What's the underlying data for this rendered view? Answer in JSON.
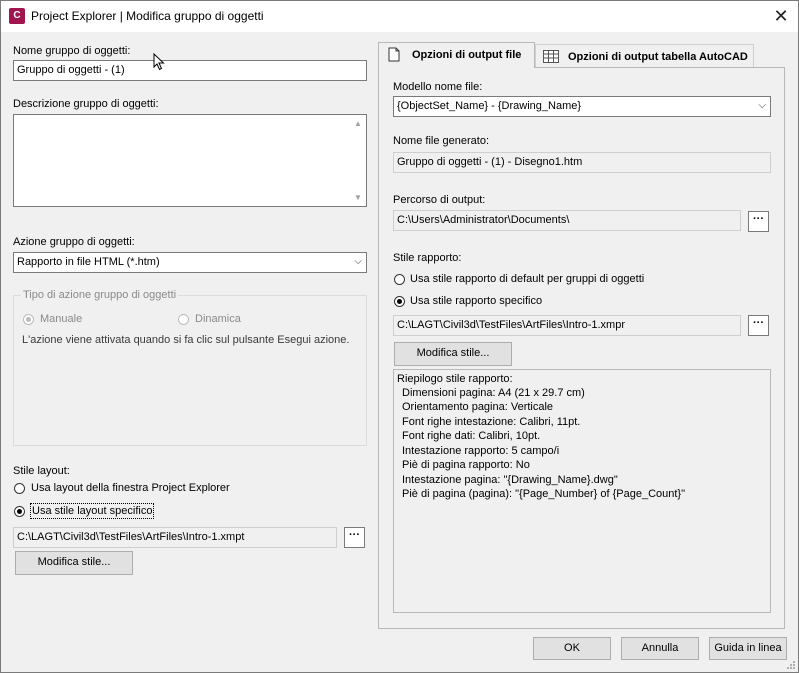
{
  "window": {
    "app_icon_text": "C",
    "title": "Project Explorer | Modifica gruppo di oggetti",
    "close_glyph": "✕"
  },
  "left": {
    "name_label": "Nome gruppo di oggetti:",
    "name_value": "Gruppo di oggetti - (1)",
    "desc_label": "Descrizione gruppo di oggetti:",
    "desc_value": "",
    "action_label": "Azione gruppo di oggetti:",
    "action_value": "Rapporto in file HTML (*.htm)",
    "action_type_group": {
      "title": "Tipo di azione gruppo di oggetti",
      "opt_manual": "Manuale",
      "opt_dynamic": "Dinamica",
      "selected": "Manuale",
      "note": "L'azione viene attivata quando si fa clic sul pulsante Esegui azione."
    },
    "layout_style_label": "Stile layout:",
    "layout_opt_window": "Usa layout della finestra Project Explorer",
    "layout_opt_specific": "Usa stile layout specifico",
    "layout_selected": "Usa stile layout specifico",
    "layout_path": "C:\\LAGT\\Civil3d\\TestFiles\\ArtFiles\\Intro-1.xmpt",
    "browse_glyph": "···",
    "modify_style_button": "Modifica stile..."
  },
  "tabs": [
    {
      "label": "Opzioni di output file",
      "icon": "document-icon",
      "active": true
    },
    {
      "label": "Opzioni di output tabella AutoCAD",
      "icon": "table-icon",
      "active": false
    }
  ],
  "output": {
    "filename_template_label": "Modello nome file:",
    "filename_template_value": "{ObjectSet_Name} - {Drawing_Name}",
    "generated_label": "Nome file generato:",
    "generated_value": "Gruppo di oggetti - (1) - Disegno1.htm",
    "path_label": "Percorso di output:",
    "path_value": "C:\\Users\\Administrator\\Documents\\",
    "browse_glyph": "···",
    "report_style_label": "Stile rapporto:",
    "report_opt_default": "Usa stile rapporto di default per gruppi di oggetti",
    "report_opt_specific": "Usa stile rapporto specifico",
    "report_selected": "Usa stile rapporto specifico",
    "report_path": "C:\\LAGT\\Civil3d\\TestFiles\\ArtFiles\\Intro-1.xmpr",
    "modify_style_button": "Modifica stile...",
    "summary_title": "Riepilogo stile rapporto:",
    "summary_lines": [
      "Dimensioni pagina: A4 (21 x 29.7 cm)",
      "Orientamento pagina: Verticale",
      "Font righe intestazione: Calibri, 11pt.",
      "Font righe dati: Calibri, 10pt.",
      "Intestazione rapporto: 5 campo/i",
      "Piè di pagina rapporto: No",
      "Intestazione pagina: \"{Drawing_Name}.dwg\"",
      "Piè di pagina (pagina): \"{Page_Number} of {Page_Count}\""
    ]
  },
  "footer": {
    "ok": "OK",
    "cancel": "Annulla",
    "help": "Guida in linea"
  }
}
